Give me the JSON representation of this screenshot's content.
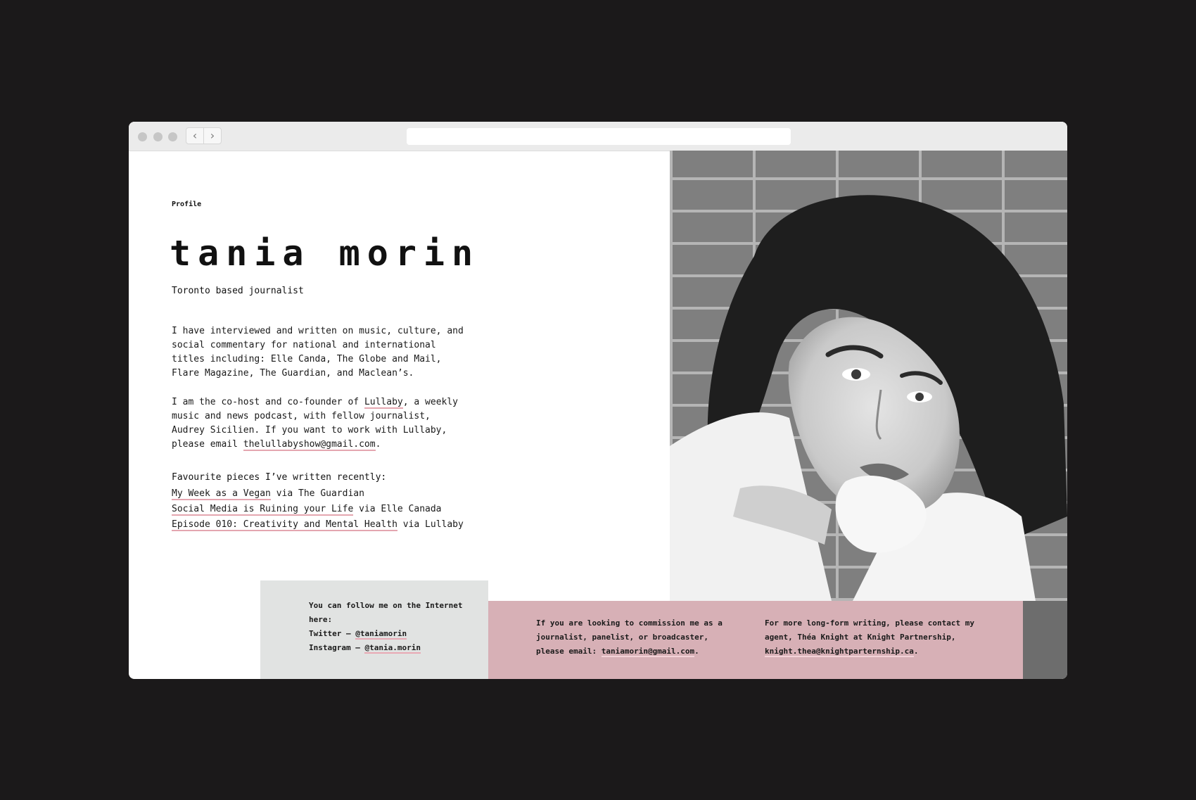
{
  "colors": {
    "backdrop": "#1b191a",
    "accent_pink": "#d7b0b6",
    "link_underline": "#e4a6b0",
    "social_box": "#e1e3e2"
  },
  "chrome": {
    "back_icon": "chevron-left-icon",
    "forward_icon": "chevron-right-icon",
    "back_glyph": "‹",
    "forward_glyph": "›"
  },
  "profile": {
    "section_label": "Profile",
    "name": "tania morin",
    "tagline": "Toronto based journalist",
    "bio_p1": "I have interviewed and written on music, culture, and social commentary for national and international titles including: Elle Canda, The Globe and Mail, Flare Magazine, The Guardian, and Maclean’s.",
    "bio_p2": {
      "before_link": "I am the co-host and co-founder of ",
      "link": "Lullaby",
      "middle": ",  a weekly music and news podcast, with fellow journalist, Audrey Sicilien. If you want to work with Lullaby, please email ",
      "email": "thelullabyshow@gmail.com",
      "after": "."
    }
  },
  "favourites": {
    "title": "Favourite pieces I’ve written recently:",
    "items": [
      {
        "link": "My Week as a Vegan",
        "via": " via The Guardian"
      },
      {
        "link": "Social Media is Ruining your Life",
        "via": " via Elle Canada"
      },
      {
        "link": "Episode 010: Creativity and Mental Health",
        "via": " via Lullaby"
      }
    ]
  },
  "social": {
    "intro": "You can follow me on the Internet here:",
    "twitter_label": "Twitter — ",
    "twitter_handle": "@taniamorin",
    "instagram_label": "Instagram — ",
    "instagram_handle": "@tania.morin"
  },
  "contact": {
    "commission_text": "If you are looking to commission me as a journalist, panelist, or broadcaster, please email: ",
    "commission_email": "taniamorin@gmail.com",
    "commission_after": ".",
    "agent_text": "For more long-form writing, please contact my agent, Théa Knight at Knight Partnership, ",
    "agent_email": "knight.thea@knightparternship.ca",
    "agent_after": "."
  }
}
